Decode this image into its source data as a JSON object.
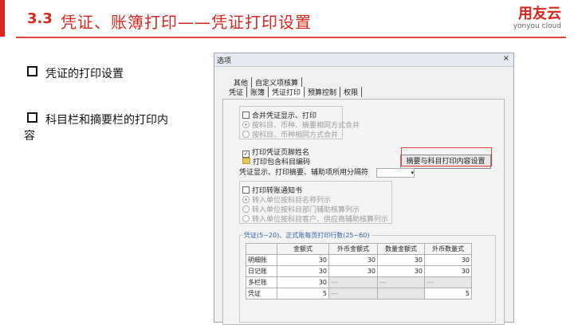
{
  "slide": {
    "section_num": "3.3",
    "title": "凭证、账簿打印——凭证打印设置",
    "logo_main": "用友云",
    "logo_sub": "yonyou cloud",
    "bullets": [
      "凭证的打印设置",
      "科目栏和摘要栏的打印内",
      "容"
    ]
  },
  "dialog": {
    "title": "选项",
    "close": "×",
    "tabs_row1": [
      "其他",
      "自定义项核算"
    ],
    "tabs_row2": [
      "凭证",
      "账簿",
      "凭证打印",
      "预算控制",
      "权限"
    ],
    "merge_check": "合并凭证显示、打印",
    "merge_opt1": "按科目、币种、摘要相同方式合并",
    "merge_opt2": "按科目、币种相同方式合并",
    "print_maker": "打印凭证页脚姓名",
    "print_code": "打印包含科目编码",
    "separator_label": "凭证显示、打印摘要、辅助项所用分隔符",
    "content_btn": "摘要与科目打印内容设置",
    "transfer_check": "打印转账通知书",
    "transfer_opt1": "转入单位按科目名称列示",
    "transfer_opt2": "转入单位按科目部门辅助核算列示",
    "transfer_opt3": "转入单位按科目客户、供应商辅助核算列示",
    "rows_legend": "凭证(5~20)、正式账每页打印行数(25~60)",
    "table_headers": [
      "",
      "金额式",
      "外币金额式",
      "数量金额式",
      "外币数量式"
    ],
    "table_rows": [
      [
        "明细账",
        "30",
        "30",
        "30",
        "30"
      ],
      [
        "日记账",
        "30",
        "30",
        "30",
        "30"
      ],
      [
        "多栏账",
        "30",
        "---",
        "---",
        "---"
      ],
      [
        "凭证",
        "5",
        "---",
        "",
        "5"
      ]
    ]
  }
}
